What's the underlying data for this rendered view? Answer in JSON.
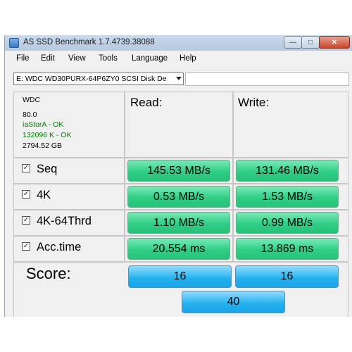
{
  "window": {
    "title": "AS SSD Benchmark 1.7.4739.38088"
  },
  "menu": [
    "File",
    "Edit",
    "View",
    "Tools",
    "Language",
    "Help"
  ],
  "drive": {
    "selected": "E: WDC WD30PURX-64P6ZY0 SCSI Disk De"
  },
  "info": {
    "vendor": "WDC",
    "firmware": "80.0",
    "driver": "iaStorA - OK",
    "alignment": "132096 K - OK",
    "capacity": "2794.52 GB"
  },
  "headers": {
    "read": "Read:",
    "write": "Write:"
  },
  "rows": [
    {
      "label": "Seq",
      "checked": true,
      "read": "145.53 MB/s",
      "write": "131.46 MB/s"
    },
    {
      "label": "4K",
      "checked": true,
      "read": "0.53 MB/s",
      "write": "1.53 MB/s"
    },
    {
      "label": "4K-64Thrd",
      "checked": true,
      "read": "1.10 MB/s",
      "write": "0.99 MB/s"
    },
    {
      "label": "Acc.time",
      "checked": true,
      "read": "20.554 ms",
      "write": "13.869 ms"
    }
  ],
  "score": {
    "label": "Score:",
    "read": "16",
    "write": "16",
    "total": "40"
  },
  "colors": {
    "result_green": "#2fcd85",
    "score_blue": "#21b0ef",
    "driver_ok": "#008000"
  }
}
